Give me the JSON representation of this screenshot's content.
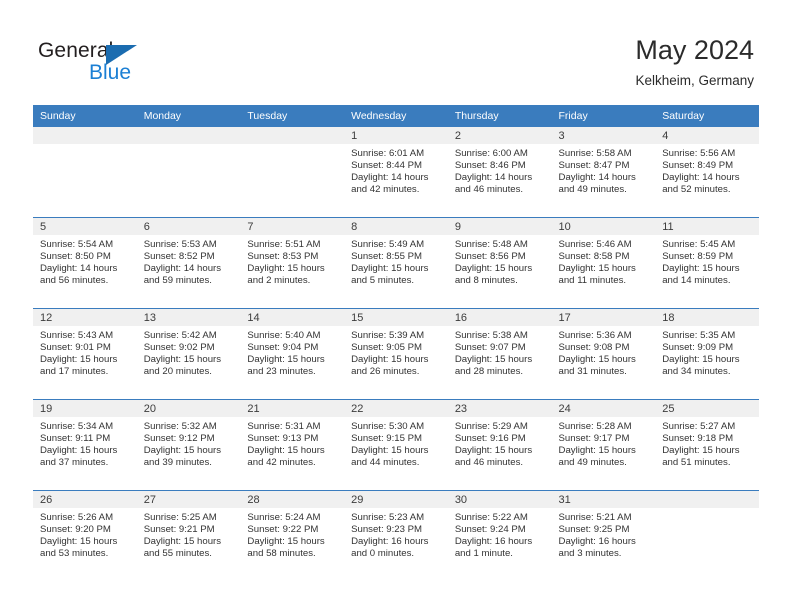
{
  "brand": {
    "name_part1": "General",
    "name_part2": "Blue",
    "triangle_color": "#1b6cb0",
    "blue_color": "#1b7fd4"
  },
  "header": {
    "title": "May 2024",
    "subtitle": "Kelkheim, Germany"
  },
  "theme": {
    "header_bg": "#3a7cbe",
    "daynum_bg": "#f0f0f0",
    "separator": "#3a7cbe",
    "text": "#333333"
  },
  "weekday_headers": [
    "Sunday",
    "Monday",
    "Tuesday",
    "Wednesday",
    "Thursday",
    "Friday",
    "Saturday"
  ],
  "weeks": [
    [
      {
        "day": "",
        "sunrise": "",
        "sunset": "",
        "daylight_line1": "",
        "daylight_line2": ""
      },
      {
        "day": "",
        "sunrise": "",
        "sunset": "",
        "daylight_line1": "",
        "daylight_line2": ""
      },
      {
        "day": "",
        "sunrise": "",
        "sunset": "",
        "daylight_line1": "",
        "daylight_line2": ""
      },
      {
        "day": "1",
        "sunrise": "Sunrise: 6:01 AM",
        "sunset": "Sunset: 8:44 PM",
        "daylight_line1": "Daylight: 14 hours",
        "daylight_line2": "and 42 minutes."
      },
      {
        "day": "2",
        "sunrise": "Sunrise: 6:00 AM",
        "sunset": "Sunset: 8:46 PM",
        "daylight_line1": "Daylight: 14 hours",
        "daylight_line2": "and 46 minutes."
      },
      {
        "day": "3",
        "sunrise": "Sunrise: 5:58 AM",
        "sunset": "Sunset: 8:47 PM",
        "daylight_line1": "Daylight: 14 hours",
        "daylight_line2": "and 49 minutes."
      },
      {
        "day": "4",
        "sunrise": "Sunrise: 5:56 AM",
        "sunset": "Sunset: 8:49 PM",
        "daylight_line1": "Daylight: 14 hours",
        "daylight_line2": "and 52 minutes."
      }
    ],
    [
      {
        "day": "5",
        "sunrise": "Sunrise: 5:54 AM",
        "sunset": "Sunset: 8:50 PM",
        "daylight_line1": "Daylight: 14 hours",
        "daylight_line2": "and 56 minutes."
      },
      {
        "day": "6",
        "sunrise": "Sunrise: 5:53 AM",
        "sunset": "Sunset: 8:52 PM",
        "daylight_line1": "Daylight: 14 hours",
        "daylight_line2": "and 59 minutes."
      },
      {
        "day": "7",
        "sunrise": "Sunrise: 5:51 AM",
        "sunset": "Sunset: 8:53 PM",
        "daylight_line1": "Daylight: 15 hours",
        "daylight_line2": "and 2 minutes."
      },
      {
        "day": "8",
        "sunrise": "Sunrise: 5:49 AM",
        "sunset": "Sunset: 8:55 PM",
        "daylight_line1": "Daylight: 15 hours",
        "daylight_line2": "and 5 minutes."
      },
      {
        "day": "9",
        "sunrise": "Sunrise: 5:48 AM",
        "sunset": "Sunset: 8:56 PM",
        "daylight_line1": "Daylight: 15 hours",
        "daylight_line2": "and 8 minutes."
      },
      {
        "day": "10",
        "sunrise": "Sunrise: 5:46 AM",
        "sunset": "Sunset: 8:58 PM",
        "daylight_line1": "Daylight: 15 hours",
        "daylight_line2": "and 11 minutes."
      },
      {
        "day": "11",
        "sunrise": "Sunrise: 5:45 AM",
        "sunset": "Sunset: 8:59 PM",
        "daylight_line1": "Daylight: 15 hours",
        "daylight_line2": "and 14 minutes."
      }
    ],
    [
      {
        "day": "12",
        "sunrise": "Sunrise: 5:43 AM",
        "sunset": "Sunset: 9:01 PM",
        "daylight_line1": "Daylight: 15 hours",
        "daylight_line2": "and 17 minutes."
      },
      {
        "day": "13",
        "sunrise": "Sunrise: 5:42 AM",
        "sunset": "Sunset: 9:02 PM",
        "daylight_line1": "Daylight: 15 hours",
        "daylight_line2": "and 20 minutes."
      },
      {
        "day": "14",
        "sunrise": "Sunrise: 5:40 AM",
        "sunset": "Sunset: 9:04 PM",
        "daylight_line1": "Daylight: 15 hours",
        "daylight_line2": "and 23 minutes."
      },
      {
        "day": "15",
        "sunrise": "Sunrise: 5:39 AM",
        "sunset": "Sunset: 9:05 PM",
        "daylight_line1": "Daylight: 15 hours",
        "daylight_line2": "and 26 minutes."
      },
      {
        "day": "16",
        "sunrise": "Sunrise: 5:38 AM",
        "sunset": "Sunset: 9:07 PM",
        "daylight_line1": "Daylight: 15 hours",
        "daylight_line2": "and 28 minutes."
      },
      {
        "day": "17",
        "sunrise": "Sunrise: 5:36 AM",
        "sunset": "Sunset: 9:08 PM",
        "daylight_line1": "Daylight: 15 hours",
        "daylight_line2": "and 31 minutes."
      },
      {
        "day": "18",
        "sunrise": "Sunrise: 5:35 AM",
        "sunset": "Sunset: 9:09 PM",
        "daylight_line1": "Daylight: 15 hours",
        "daylight_line2": "and 34 minutes."
      }
    ],
    [
      {
        "day": "19",
        "sunrise": "Sunrise: 5:34 AM",
        "sunset": "Sunset: 9:11 PM",
        "daylight_line1": "Daylight: 15 hours",
        "daylight_line2": "and 37 minutes."
      },
      {
        "day": "20",
        "sunrise": "Sunrise: 5:32 AM",
        "sunset": "Sunset: 9:12 PM",
        "daylight_line1": "Daylight: 15 hours",
        "daylight_line2": "and 39 minutes."
      },
      {
        "day": "21",
        "sunrise": "Sunrise: 5:31 AM",
        "sunset": "Sunset: 9:13 PM",
        "daylight_line1": "Daylight: 15 hours",
        "daylight_line2": "and 42 minutes."
      },
      {
        "day": "22",
        "sunrise": "Sunrise: 5:30 AM",
        "sunset": "Sunset: 9:15 PM",
        "daylight_line1": "Daylight: 15 hours",
        "daylight_line2": "and 44 minutes."
      },
      {
        "day": "23",
        "sunrise": "Sunrise: 5:29 AM",
        "sunset": "Sunset: 9:16 PM",
        "daylight_line1": "Daylight: 15 hours",
        "daylight_line2": "and 46 minutes."
      },
      {
        "day": "24",
        "sunrise": "Sunrise: 5:28 AM",
        "sunset": "Sunset: 9:17 PM",
        "daylight_line1": "Daylight: 15 hours",
        "daylight_line2": "and 49 minutes."
      },
      {
        "day": "25",
        "sunrise": "Sunrise: 5:27 AM",
        "sunset": "Sunset: 9:18 PM",
        "daylight_line1": "Daylight: 15 hours",
        "daylight_line2": "and 51 minutes."
      }
    ],
    [
      {
        "day": "26",
        "sunrise": "Sunrise: 5:26 AM",
        "sunset": "Sunset: 9:20 PM",
        "daylight_line1": "Daylight: 15 hours",
        "daylight_line2": "and 53 minutes."
      },
      {
        "day": "27",
        "sunrise": "Sunrise: 5:25 AM",
        "sunset": "Sunset: 9:21 PM",
        "daylight_line1": "Daylight: 15 hours",
        "daylight_line2": "and 55 minutes."
      },
      {
        "day": "28",
        "sunrise": "Sunrise: 5:24 AM",
        "sunset": "Sunset: 9:22 PM",
        "daylight_line1": "Daylight: 15 hours",
        "daylight_line2": "and 58 minutes."
      },
      {
        "day": "29",
        "sunrise": "Sunrise: 5:23 AM",
        "sunset": "Sunset: 9:23 PM",
        "daylight_line1": "Daylight: 16 hours",
        "daylight_line2": "and 0 minutes."
      },
      {
        "day": "30",
        "sunrise": "Sunrise: 5:22 AM",
        "sunset": "Sunset: 9:24 PM",
        "daylight_line1": "Daylight: 16 hours",
        "daylight_line2": "and 1 minute."
      },
      {
        "day": "31",
        "sunrise": "Sunrise: 5:21 AM",
        "sunset": "Sunset: 9:25 PM",
        "daylight_line1": "Daylight: 16 hours",
        "daylight_line2": "and 3 minutes."
      },
      {
        "day": "",
        "sunrise": "",
        "sunset": "",
        "daylight_line1": "",
        "daylight_line2": ""
      }
    ]
  ]
}
